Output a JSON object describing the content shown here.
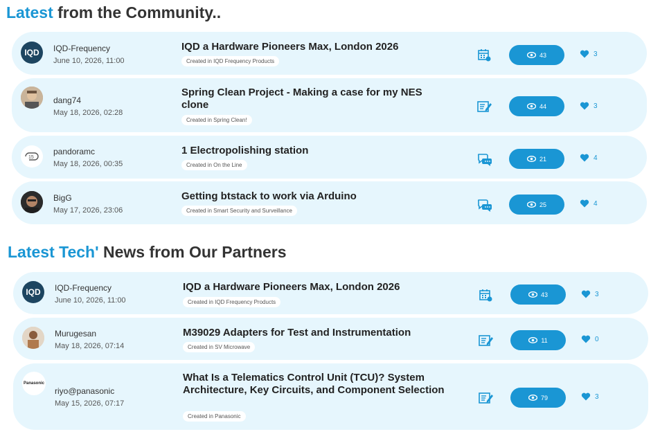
{
  "sections": [
    {
      "accent": "Latest",
      "rest": " from the Community.."
    },
    {
      "accent": "Latest Tech'",
      "rest": " News from Our Partners"
    }
  ],
  "community": [
    {
      "author": "IQD-Frequency",
      "date": "June 10, 2026, 11:00",
      "title": "IQD a Hardware Pioneers Max, London 2026",
      "tag": "Created in IQD Frequency Products",
      "type_icon": "calendar-icon",
      "views": "43",
      "likes": "3",
      "avatar": "iqd-logo"
    },
    {
      "author": "dang74",
      "date": "May 18, 2026, 02:28",
      "title": "Spring Clean Project - Making a case for my NES clone",
      "tag": "Created in Spring Clean!",
      "type_icon": "blog-edit-icon",
      "views": "44",
      "likes": "3",
      "avatar": "user-photo"
    },
    {
      "author": "pandoramc",
      "date": "May 18, 2026, 00:35",
      "title": "1 Electropolishing station",
      "tag": "Created in On the Line",
      "type_icon": "discussion-icon",
      "views": "21",
      "likes": "4",
      "avatar": "pandoramc-logo"
    },
    {
      "author": "BigG",
      "date": "May 17, 2026, 23:06",
      "title": "Getting btstack to work via Arduino",
      "tag": "Created in Smart Security and Surveillance",
      "type_icon": "discussion-icon",
      "views": "25",
      "likes": "4",
      "avatar": "user-photo"
    }
  ],
  "partners": [
    {
      "author": "IQD-Frequency",
      "date": "June 10, 2026, 11:00",
      "title": "IQD a Hardware Pioneers Max, London 2026",
      "tag": "Created in IQD Frequency Products",
      "type_icon": "calendar-icon",
      "views": "43",
      "likes": "3",
      "avatar": "iqd-logo"
    },
    {
      "author": "Murugesan",
      "date": "May 18, 2026, 07:14",
      "title": "M39029 Adapters for Test and Instrumentation",
      "tag": "Created in SV Microwave",
      "type_icon": "blog-edit-icon",
      "views": "11",
      "likes": "0",
      "avatar": "user-photo"
    },
    {
      "author": "riyo@panasonic",
      "date": "May 15, 2026, 07:17",
      "title": "What Is a Telematics Control Unit (TCU)? System Architecture, Key Circuits, and Component Selection",
      "tag": "Created in Panasonic",
      "type_icon": "blog-edit-icon",
      "views": "79",
      "likes": "3",
      "avatar": "panasonic-logo"
    }
  ],
  "logos": {
    "iqd": "IQD",
    "panasonic": "Panasonic"
  },
  "colors": {
    "accent": "#1a96d4",
    "card": "#e6f6fd"
  }
}
